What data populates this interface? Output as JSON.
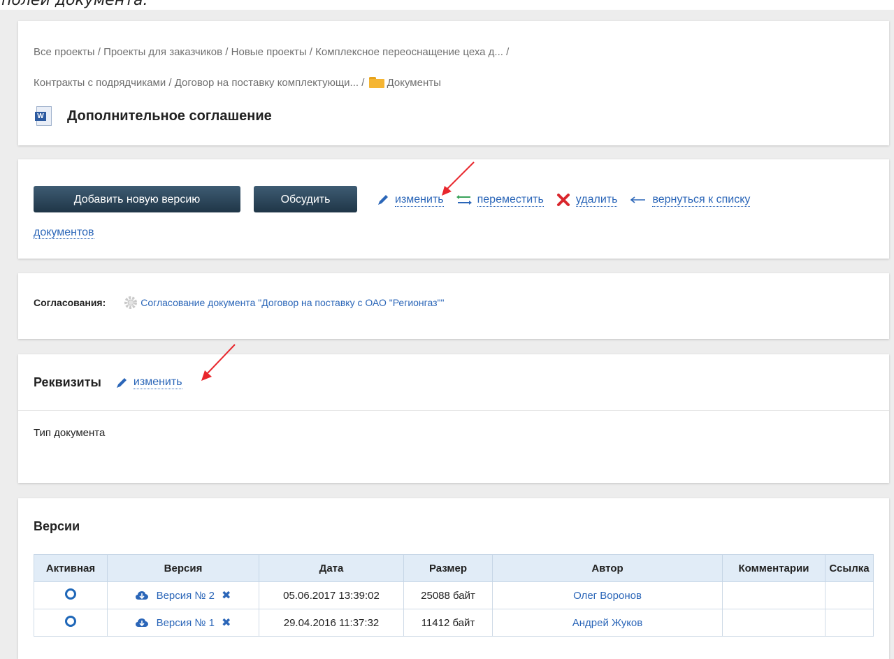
{
  "caption": "полей документа.",
  "breadcrumb": {
    "line1": [
      "Все проекты",
      "Проекты для заказчиков",
      "Новые проекты",
      "Комплексное переоснащение цеха д..."
    ],
    "line2": [
      "Контракты с подрядчиками",
      "Договор на поставку комплектующи..."
    ],
    "current": "Документы",
    "sep": " / "
  },
  "document": {
    "title": "Дополнительное соглашение",
    "icon": "word-doc-icon"
  },
  "actions": {
    "add_version": "Добавить новую версию",
    "discuss": "Обсудить",
    "edit": "изменить",
    "move": "переместить",
    "delete": "удалить",
    "back": "вернуться к списку",
    "back_cont": "документов"
  },
  "approvals": {
    "label": "Согласования:",
    "item": "Согласование документа \"Договор на поставку с ОАО \"Регионгаз\"\""
  },
  "requisites": {
    "heading": "Реквизиты",
    "edit": "изменить",
    "field": "Тип документа"
  },
  "versions": {
    "heading": "Версии",
    "columns": [
      "Активная",
      "Версия",
      "Дата",
      "Размер",
      "Автор",
      "Комментарии",
      "Ссылка"
    ],
    "rows": [
      {
        "version": "Версия № 2",
        "date": "05.06.2017 13:39:02",
        "size": "25088 байт",
        "author": "Олег Воронов",
        "comment": "",
        "link": ""
      },
      {
        "version": "Версия № 1",
        "date": "29.04.2016 11:37:32",
        "size": "11412 байт",
        "author": "Андрей Жуков",
        "comment": "",
        "link": ""
      }
    ]
  },
  "colors": {
    "link": "#2b66b8",
    "button": "#2a4457",
    "annotation": "#e8262c",
    "table_head": "#e1ecf7"
  }
}
